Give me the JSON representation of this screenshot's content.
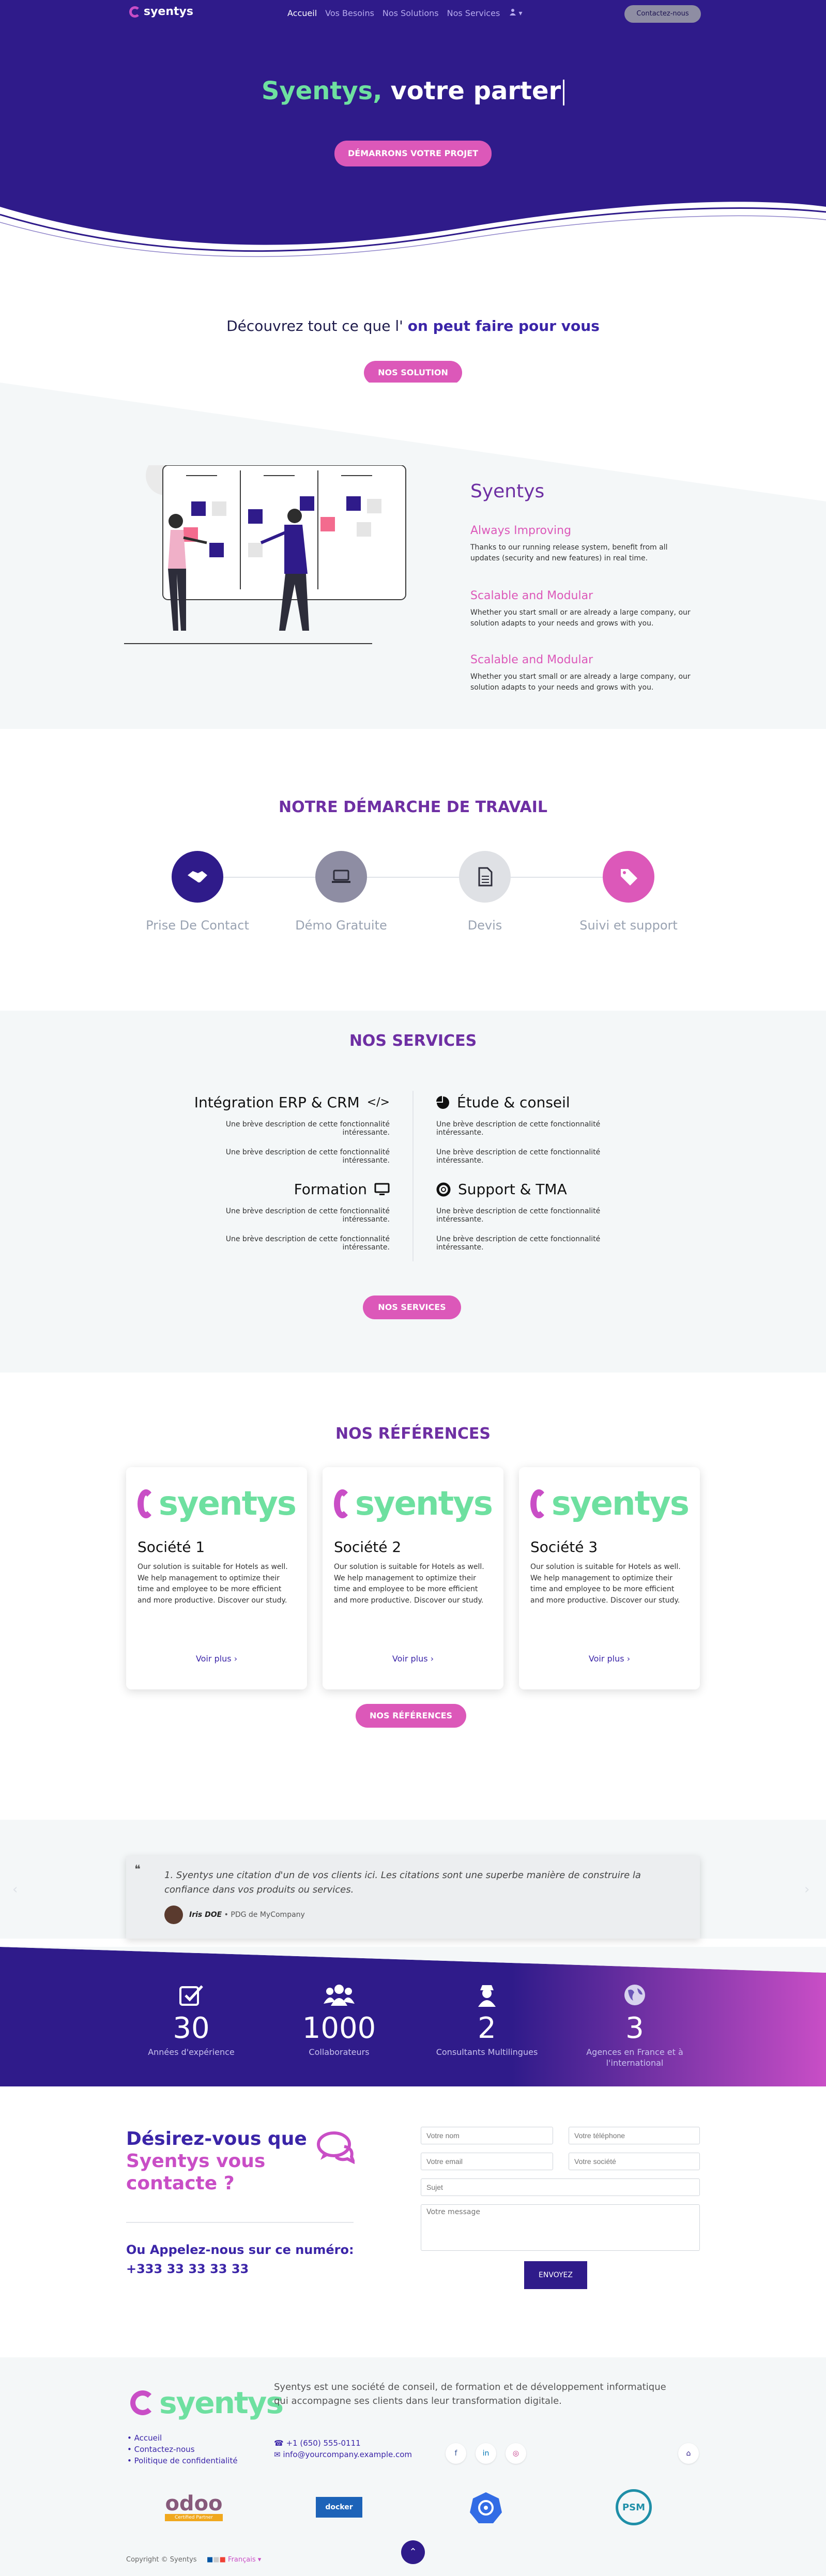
{
  "colors": {
    "primary": "#2f1b8a",
    "accent": "#dc58b9",
    "brand_green": "#6ee0a0",
    "heading_purple": "#6e2fa3"
  },
  "nav": {
    "logo_text": "syentys",
    "links": [
      "Accueil",
      "Vos Besoins",
      "Nos Solutions",
      "Nos Services"
    ],
    "user_icon": "user-icon",
    "cta": "Contactez-nous"
  },
  "hero": {
    "brand": "Syentys,",
    "title": "votre parter",
    "cta": "DÉMARRONS VOTRE PROJET"
  },
  "discover": {
    "title_start": "Découvrez tout ce que l'",
    "title_highlight": "on peut faire pour vous",
    "cta": "NOS SOLUTION"
  },
  "feature": {
    "title": "Syentys",
    "items": [
      {
        "title": "Always Improving",
        "text": "Thanks to our running release system, benefit from all updates (security and new features) in real time."
      },
      {
        "title": "Scalable and Modular",
        "text": "Whether you start small or are already a large company, our solution adapts to your needs and grows with you."
      },
      {
        "title": "Scalable and Modular",
        "text": "Whether you start small or are already a large company, our solution adapts to your needs and grows with you."
      }
    ]
  },
  "process": {
    "title": "NOTRE DÉMARCHE DE TRAVAIL",
    "steps": [
      {
        "label": "Prise De Contact",
        "icon": "handshake-icon",
        "color": "#2f1b8a"
      },
      {
        "label": "Démo Gratuite",
        "icon": "laptop-icon",
        "color": "#8e8da3"
      },
      {
        "label": "Devis",
        "icon": "document-icon",
        "color": "#dfe1e5"
      },
      {
        "label": "Suivi et support",
        "icon": "tags-icon",
        "color": "#dc58b9"
      }
    ]
  },
  "services": {
    "title": "NOS SERVICES",
    "items": [
      {
        "title": "Intégration ERP & CRM",
        "icon": "code-icon",
        "lines": [
          "Une brève description de cette fonctionnalité intéressante.",
          "Une brève description de cette fonctionnalité intéressante."
        ]
      },
      {
        "title": "Étude & conseil",
        "icon": "pie-chart-icon",
        "lines": [
          "Une brève description de cette fonctionnalité intéressante.",
          "Une brève description de cette fonctionnalité intéressante."
        ]
      },
      {
        "title": "Formation",
        "icon": "monitor-icon",
        "lines": [
          "Une brève description de cette fonctionnalité intéressante.",
          "Une brève description de cette fonctionnalité intéressante."
        ]
      },
      {
        "title": "Support & TMA",
        "icon": "lifebuoy-icon",
        "lines": [
          "Une brève description de cette fonctionnalité intéressante.",
          "Une brève description de cette fonctionnalité intéressante."
        ]
      }
    ],
    "cta": "NOS SERVICES"
  },
  "references": {
    "title": "NOS RÉFÉRENCES",
    "logo_text": "syentys",
    "cards": [
      {
        "name": "Société 1",
        "text": "Our solution is suitable for Hotels as well. We help management to optimize their time and employee to be more efficient and more productive. Discover our study.",
        "link": "Voir plus"
      },
      {
        "name": "Société 2",
        "text": "Our solution is suitable for Hotels as well. We help management to optimize their time and employee to be more efficient and more productive. Discover our study.",
        "link": "Voir plus"
      },
      {
        "name": "Société 3",
        "text": "Our solution is suitable for Hotels as well. We help management to optimize their time and employee to be more efficient and more productive. Discover our study.",
        "link": "Voir plus"
      }
    ],
    "cta": "NOS RÉFÉRENCES"
  },
  "testimonial": {
    "text": "1. Syentys une citation d'un de vos clients ici. Les citations sont une superbe manière de construire la confiance dans vos produits ou services.",
    "author": "Iris DOE",
    "role": "• PDG de MyCompany"
  },
  "stats": [
    {
      "icon": "check-icon",
      "value": "30",
      "label": "Années d'expérience"
    },
    {
      "icon": "users-icon",
      "value": "1000",
      "label": "Collaborateurs"
    },
    {
      "icon": "user-secret-icon",
      "value": "2",
      "label": "Consultants Multilingues"
    },
    {
      "icon": "globe-icon",
      "value": "3",
      "label": "Agences en France et à l'international"
    }
  ],
  "contact": {
    "title_1": "Désirez-vous que",
    "title_2": "Syentys vous",
    "title_3": "contacte ?",
    "call_label": "Ou Appelez-nous  sur ce numéro:",
    "phone": "+333 33 33 33 33",
    "placeholders": {
      "name": "Votre nom",
      "phone": "Votre téléphone",
      "email": "Votre email",
      "company": "Votre société",
      "subject": "Sujet",
      "message": "Votre message"
    },
    "submit": "ENVOYEZ"
  },
  "footer": {
    "logo_text": "syentys",
    "description": "Syentys est une société de conseil, de formation et de développement informatique qui accompagne ses clients dans leur transformation digitale.",
    "links": [
      "Accueil",
      "Contactez-nous",
      "Politique de confidentialité"
    ],
    "phone": "+1 (650) 555-0111",
    "email": "info@yourcompany.example.com",
    "social": [
      "f",
      "in",
      "◎"
    ],
    "home_icon": "home-icon",
    "partners": {
      "odoo": "odoo",
      "odoo_sub": "Certified Partner",
      "docker": "docker",
      "psm": "PSM"
    },
    "copyright": "Copyright © Syentys",
    "language": "Français"
  }
}
